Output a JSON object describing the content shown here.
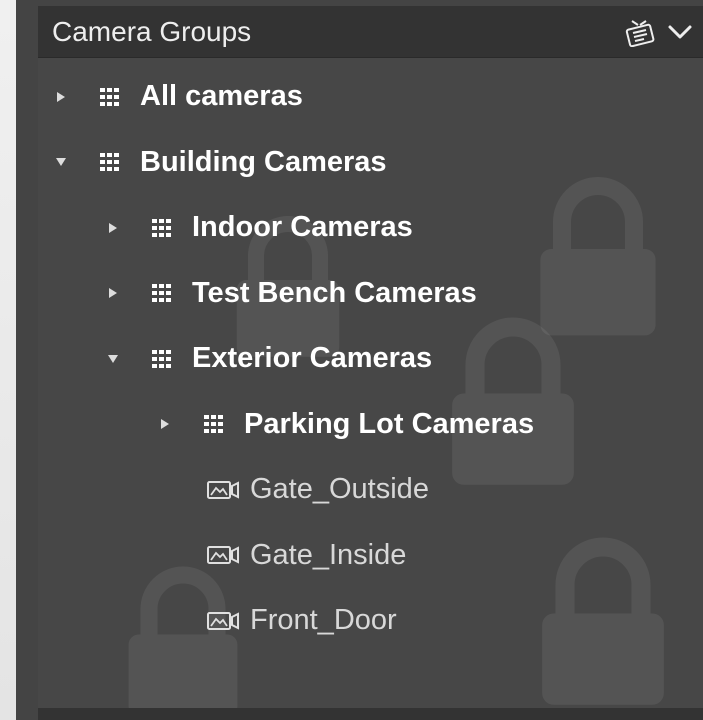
{
  "panel": {
    "title": "Camera Groups",
    "header_icons": [
      "dashboard-icon",
      "chevron-down-icon"
    ]
  },
  "tree": {
    "all_cameras": "All cameras",
    "building_cameras": "Building Cameras",
    "indoor_cameras": "Indoor Cameras",
    "test_bench_cameras": "Test Bench Cameras",
    "exterior_cameras": "Exterior Cameras",
    "parking_lot_cameras": "Parking Lot Cameras",
    "gate_outside": "Gate_Outside",
    "gate_inside": "Gate_Inside",
    "front_door": "Front_Door"
  },
  "colors": {
    "panel_bg": "#474747",
    "header_bg": "#333333",
    "group_text": "#ffffff",
    "camera_text": "#d8d8d8"
  }
}
